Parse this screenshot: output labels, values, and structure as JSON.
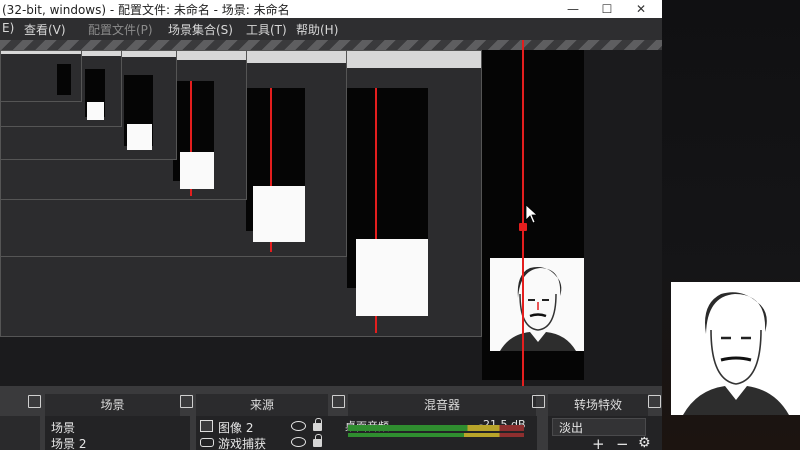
{
  "window": {
    "title": "(32-bit, windows) - 配置文件: 未命名 - 场景: 未命名",
    "controls": [
      "—",
      "☐",
      "✕"
    ]
  },
  "menu": [
    "E)",
    "查看(V)",
    "配置文件(P)",
    "场景集合(S)",
    "工具(T)",
    "帮助(H)"
  ],
  "docks": {
    "scenes": {
      "title": "场景",
      "items": [
        "场景",
        "场景 2"
      ]
    },
    "sources": {
      "title": "来源",
      "items": [
        "图像 2",
        "游戏捕获"
      ]
    },
    "mixer": {
      "title": "混音器",
      "track_name": "桌面音频",
      "level": "-21.5 dB"
    },
    "transitions": {
      "title": "转场特效",
      "selected": "淡出",
      "add": "+",
      "remove": "−",
      "settings": "⚙"
    }
  },
  "colors": {
    "accent_red": "#e41e1e",
    "meter_green": "#2f8d2f",
    "meter_yellow": "#b8a42a"
  }
}
